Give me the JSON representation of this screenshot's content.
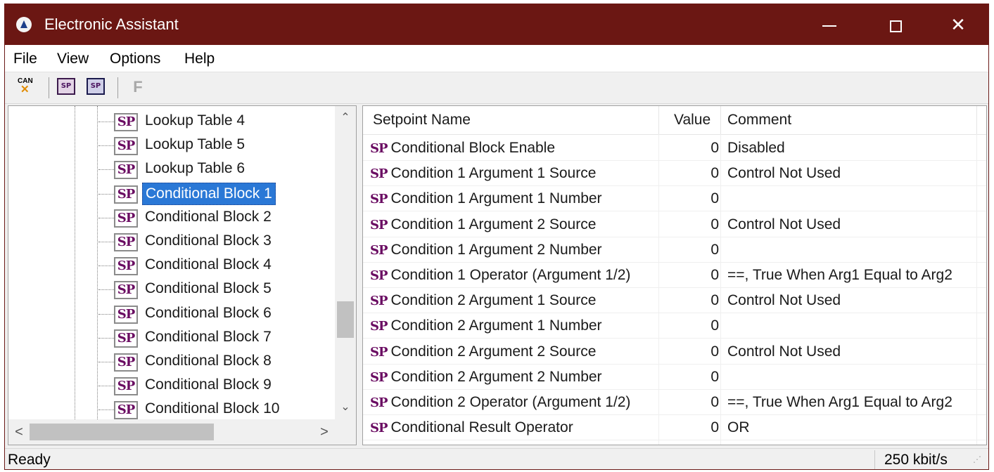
{
  "window": {
    "title": "Electronic Assistant"
  },
  "menu": [
    "File",
    "View",
    "Options",
    "Help"
  ],
  "toolbar": {
    "can_label": "CAN",
    "sp_open_label": "SP",
    "sp_save_label": "SP",
    "f_label": "F"
  },
  "tree": {
    "sp_badge": "SP",
    "items": [
      "Lookup Table 4",
      "Lookup Table 5",
      "Lookup Table 6",
      "Conditional Block 1",
      "Conditional Block 2",
      "Conditional Block 3",
      "Conditional Block 4",
      "Conditional Block 5",
      "Conditional Block 6",
      "Conditional Block 7",
      "Conditional Block 8",
      "Conditional Block 9",
      "Conditional Block 10"
    ],
    "selected_index": 3,
    "scroll_up": "^",
    "scroll_down": "v",
    "scroll_left": "<",
    "scroll_right": ">"
  },
  "table": {
    "columns": [
      "Setpoint Name",
      "Value",
      "Comment"
    ],
    "sp_badge": "SP",
    "rows": [
      {
        "name": "Conditional Block Enable",
        "value": "0",
        "comment": "Disabled"
      },
      {
        "name": "Condition 1 Argument 1 Source",
        "value": "0",
        "comment": "Control Not Used"
      },
      {
        "name": "Condition 1 Argument 1 Number",
        "value": "0",
        "comment": ""
      },
      {
        "name": "Condition 1 Argument 2 Source",
        "value": "0",
        "comment": "Control Not Used"
      },
      {
        "name": "Condition 1 Argument 2 Number",
        "value": "0",
        "comment": ""
      },
      {
        "name": "Condition 1 Operator (Argument 1/2)",
        "value": "0",
        "comment": "==, True When Arg1 Equal to Arg2"
      },
      {
        "name": "Condition 2 Argument 1 Source",
        "value": "0",
        "comment": "Control Not Used"
      },
      {
        "name": "Condition 2 Argument 1 Number",
        "value": "0",
        "comment": ""
      },
      {
        "name": "Condition 2 Argument 2 Source",
        "value": "0",
        "comment": "Control Not Used"
      },
      {
        "name": "Condition 2 Argument 2 Number",
        "value": "0",
        "comment": ""
      },
      {
        "name": "Condition 2 Operator (Argument 1/2)",
        "value": "0",
        "comment": "==, True When Arg1 Equal to Arg2"
      },
      {
        "name": "Conditional Result Operator",
        "value": "0",
        "comment": "OR"
      }
    ]
  },
  "status": {
    "text": "Ready",
    "baud": "250 kbit/s"
  },
  "colors": {
    "titlebar": "#6b1713",
    "selection": "#2a78d6",
    "sp_text": "#6a0c62"
  }
}
